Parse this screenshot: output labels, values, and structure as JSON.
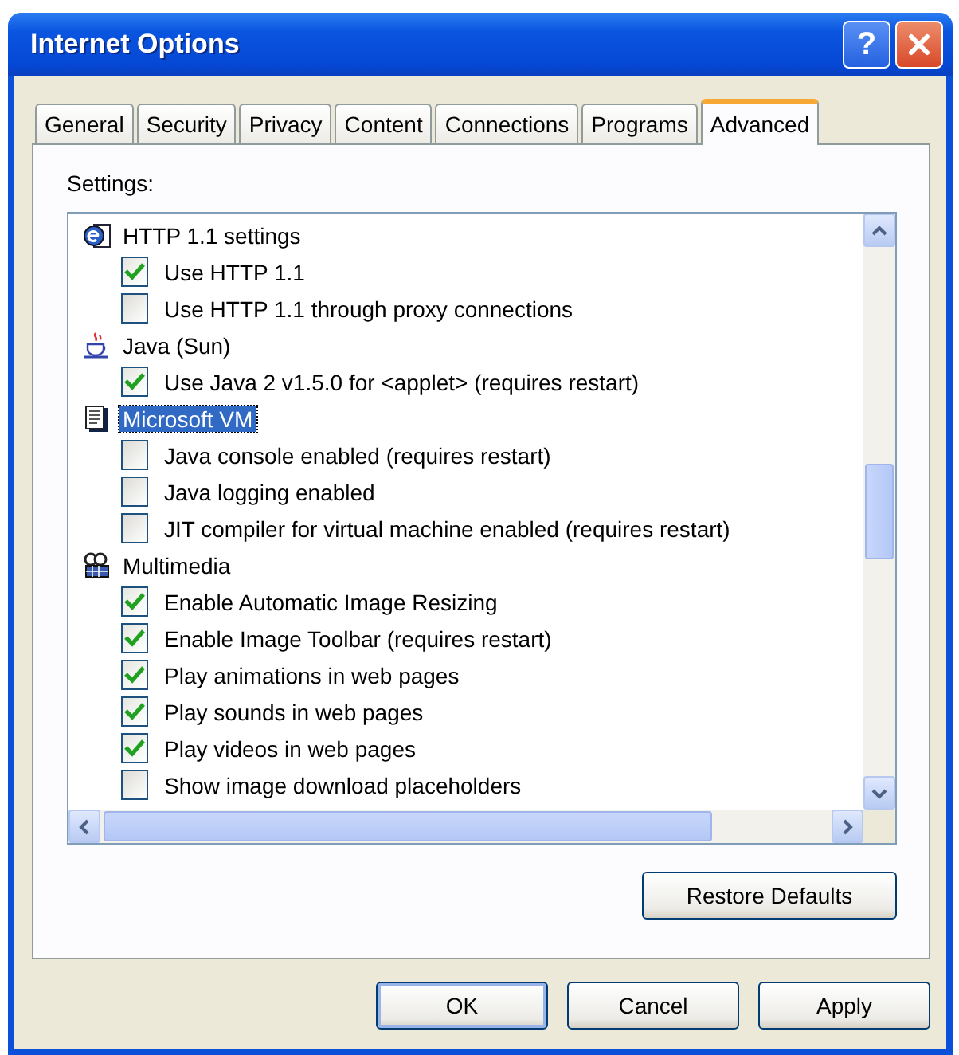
{
  "window": {
    "title": "Internet Options",
    "help_button": "?"
  },
  "tabs": [
    {
      "label": "General",
      "selected": false
    },
    {
      "label": "Security",
      "selected": false
    },
    {
      "label": "Privacy",
      "selected": false
    },
    {
      "label": "Content",
      "selected": false
    },
    {
      "label": "Connections",
      "selected": false
    },
    {
      "label": "Programs",
      "selected": false
    },
    {
      "label": "Advanced",
      "selected": true
    }
  ],
  "settings_label": "Settings:",
  "settings": [
    {
      "label": "HTTP 1.1 settings",
      "kind": "web",
      "selected": false,
      "children": [
        {
          "label": "Use HTTP 1.1",
          "checked": true
        },
        {
          "label": "Use HTTP 1.1 through proxy connections",
          "checked": false
        }
      ]
    },
    {
      "label": "Java (Sun)",
      "kind": "java",
      "selected": false,
      "children": [
        {
          "label": "Use Java 2 v1.5.0 for <applet> (requires restart)",
          "checked": true
        }
      ]
    },
    {
      "label": "Microsoft VM",
      "kind": "document",
      "selected": true,
      "children": [
        {
          "label": "Java console enabled (requires restart)",
          "checked": false
        },
        {
          "label": "Java logging enabled",
          "checked": false
        },
        {
          "label": "JIT compiler for virtual machine enabled (requires restart)",
          "checked": false
        }
      ]
    },
    {
      "label": "Multimedia",
      "kind": "media",
      "selected": false,
      "children": [
        {
          "label": "Enable Automatic Image Resizing",
          "checked": true
        },
        {
          "label": "Enable Image Toolbar (requires restart)",
          "checked": true
        },
        {
          "label": "Play animations in web pages",
          "checked": true
        },
        {
          "label": "Play sounds in web pages",
          "checked": true
        },
        {
          "label": "Play videos in web pages",
          "checked": true
        },
        {
          "label": "Show image download placeholders",
          "checked": false
        }
      ]
    }
  ],
  "restore_button": "Restore Defaults",
  "buttons": [
    "OK",
    "Cancel",
    "Apply"
  ]
}
